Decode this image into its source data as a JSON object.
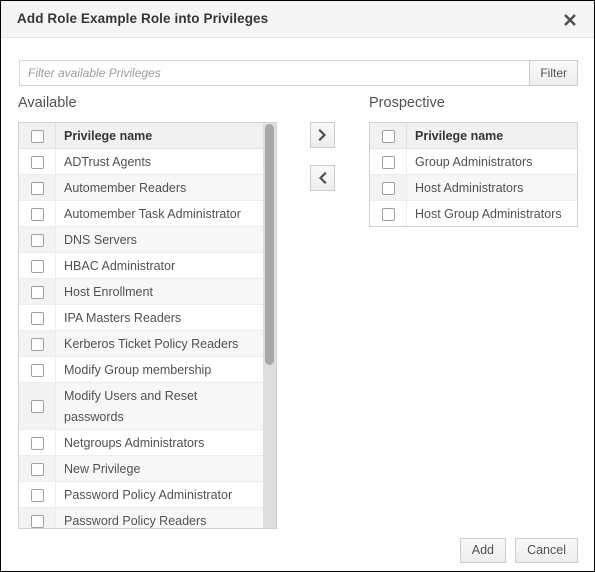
{
  "dialog": {
    "title": "Add Role Example Role into Privileges",
    "close_icon": "close-icon"
  },
  "filter": {
    "placeholder": "Filter available Privileges",
    "value": "",
    "button_label": "Filter"
  },
  "available": {
    "label": "Available",
    "column_header": "Privilege name",
    "items": [
      "ADTrust Agents",
      "Automember Readers",
      "Automember Task Administrator",
      "DNS Servers",
      "HBAC Administrator",
      "Host Enrollment",
      "IPA Masters Readers",
      "Kerberos Ticket Policy Readers",
      "Modify Group membership",
      "Modify Users and Reset passwords",
      "Netgroups Administrators",
      "New Privilege",
      "Password Policy Administrator",
      "Password Policy Readers"
    ]
  },
  "prospective": {
    "label": "Prospective",
    "column_header": "Privilege name",
    "items": [
      "Group Administrators",
      "Host Administrators",
      "Host Group Administrators"
    ]
  },
  "move_buttons": {
    "right_icon": "chevron-right-icon",
    "left_icon": "chevron-left-icon"
  },
  "footer": {
    "add_label": "Add",
    "cancel_label": "Cancel"
  }
}
